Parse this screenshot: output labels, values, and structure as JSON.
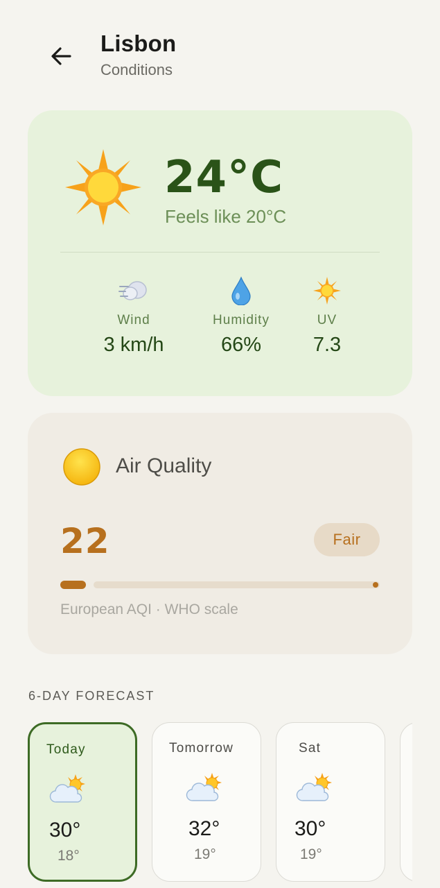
{
  "header": {
    "title": "Lisbon",
    "subtitle": "Conditions"
  },
  "current": {
    "temperature": "24°C",
    "feels_like": "Feels like 20°C",
    "condition_icon": "sun-icon",
    "metrics": [
      {
        "label": "Wind",
        "value": "3 km/h",
        "icon": "wind-icon"
      },
      {
        "label": "Humidity",
        "value": "66%",
        "icon": "droplet-icon"
      },
      {
        "label": "UV",
        "value": "7.3",
        "icon": "sun-icon"
      }
    ]
  },
  "air_quality": {
    "title": "Air Quality",
    "value": "22",
    "badge": "Fair",
    "note": "European AQI · WHO scale",
    "level_fraction": 0.08,
    "icon": "yellow-circle-icon"
  },
  "forecast": {
    "heading": "6-DAY FORECAST",
    "days": [
      {
        "name": "Today",
        "high": "30°",
        "low": "18°",
        "icon": "sun-behind-cloud-icon",
        "selected": true
      },
      {
        "name": "Tomorrow",
        "high": "32°",
        "low": "19°",
        "icon": "sun-behind-cloud-icon",
        "selected": false
      },
      {
        "name": "Sat",
        "high": "30°",
        "low": "19°",
        "icon": "sun-behind-cloud-icon",
        "selected": false
      }
    ]
  },
  "colors": {
    "background": "#f5f4ef",
    "current_card": "#e7f2dc",
    "temp_green": "#2a5318",
    "aqi_card": "#f0ece4",
    "aqi_accent": "#b7701e",
    "selected_border": "#3d6b25"
  }
}
